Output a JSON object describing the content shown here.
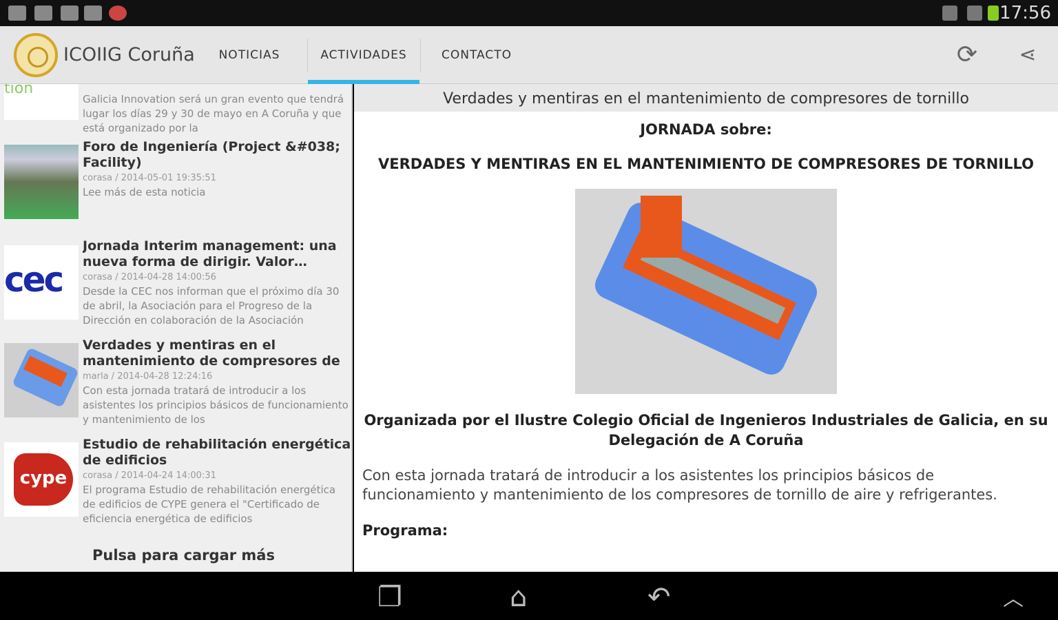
{
  "status_bar": {
    "time": "17:56",
    "icons": [
      "gmail-icon",
      "gallery-icon",
      "shop-icon",
      "mail-icon",
      "app-icon",
      "mute-icon",
      "wifi-icon",
      "battery-icon"
    ]
  },
  "app": {
    "title": "ICOIIG Coruña",
    "tabs": [
      {
        "label": "NOTICIAS"
      },
      {
        "label": "ACTIVIDADES",
        "active": true
      },
      {
        "label": "CONTACTO"
      }
    ],
    "actions": [
      "refresh-icon",
      "share-icon"
    ]
  },
  "colors": {
    "accent": "#33b5e5"
  },
  "list": {
    "items": [
      {
        "title": "",
        "meta": "",
        "desc": "Galicia Innovation será un gran evento que tendrá lugar los días 29 y 30 de mayo en A Coruña y que está organizado por la"
      },
      {
        "title": "Foro de Ingeniería (Project &#038; Facility)",
        "meta": "corasa / 2014-05-01 19:35:51",
        "desc": "Lee más de esta noticia"
      },
      {
        "title": "Jornada Interim management: una nueva forma de dirigir. Valor diferencia...",
        "meta": "corasa / 2014-04-28 14:00:56",
        "desc": "Desde la CEC nos informan que el próximo día 30 de abril, la Asociación para el Progreso de la Dirección en colaboración de la Asociación"
      },
      {
        "title": "Verdades y mentiras en el mantenimiento de compresores de",
        "meta": "marla / 2014-04-28 12:24:16",
        "desc": "Con esta jornada tratará de introducir a los asistentes los principios básicos de funcionamiento y mantenimiento de los"
      },
      {
        "title": "Estudio de rehabilitación energética de edificios",
        "meta": "corasa / 2014-04-24 14:00:31",
        "desc": "El programa Estudio de rehabilitación energética de edificios de CYPE genera el \"Certificado de eficiencia energética de edificios"
      }
    ],
    "load_more": "Pulsa para cargar más",
    "logos": {
      "cec": "cec",
      "cype": "cype",
      "innovation": "tion"
    }
  },
  "detail": {
    "header": "Verdades y mentiras en el mantenimiento de compresores de tornillo",
    "jornada": "JORNADA sobre:",
    "headline": "VERDADES Y MENTIRAS EN EL MANTENIMIENTO DE COMPRESORES DE TORNILLO",
    "organizer": "Organizada por el Ilustre Colegio Oficial de Ingenieros Industriales de Galicia, en su Delegación de   A Coruña",
    "intro": "Con esta jornada tratará de introducir a los asistentes los principios básicos de funcionamiento y mantenimiento de los compresores de tornillo de aire y refrigerantes.",
    "programa": "Programa:"
  },
  "nav": [
    "recent-apps-icon",
    "home-icon",
    "back-icon",
    "menu-up-icon"
  ]
}
